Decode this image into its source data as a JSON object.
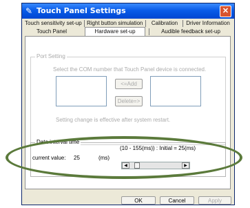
{
  "window": {
    "title": "Touch Panel Settings"
  },
  "tabs": {
    "row1": [
      "Touch sensitivity set-up",
      "Right button simulation",
      "Calibration",
      "Driver Information"
    ],
    "row2": [
      "Touch Panel",
      "Hardware set-up",
      "Audible feedback set-up"
    ],
    "selected": "Hardware set-up"
  },
  "port_setting": {
    "title": "Port Setting",
    "instruction": "Select the COM number that Touch Panel device is connected.",
    "add_label": "<=Add",
    "delete_label": "Delete=>",
    "note": "Setting change is effective after system restart."
  },
  "data_interval": {
    "title": "Data interval time",
    "range_text": "(10 - 155(ms)) : Initial = 25(ms)",
    "current_label": "current value:",
    "current_value": "25",
    "unit": "(ms)",
    "slider_level_fraction": 0.1
  },
  "buttons": {
    "ok": "OK",
    "cancel": "Cancel",
    "apply": "Apply"
  },
  "colors": {
    "titlebar": "#0a5ce8",
    "highlight_ellipse": "#5b7a3b",
    "dialog_bg": "#ece9d8"
  },
  "icons": {
    "title": "pencil-icon",
    "close": "close-icon"
  }
}
